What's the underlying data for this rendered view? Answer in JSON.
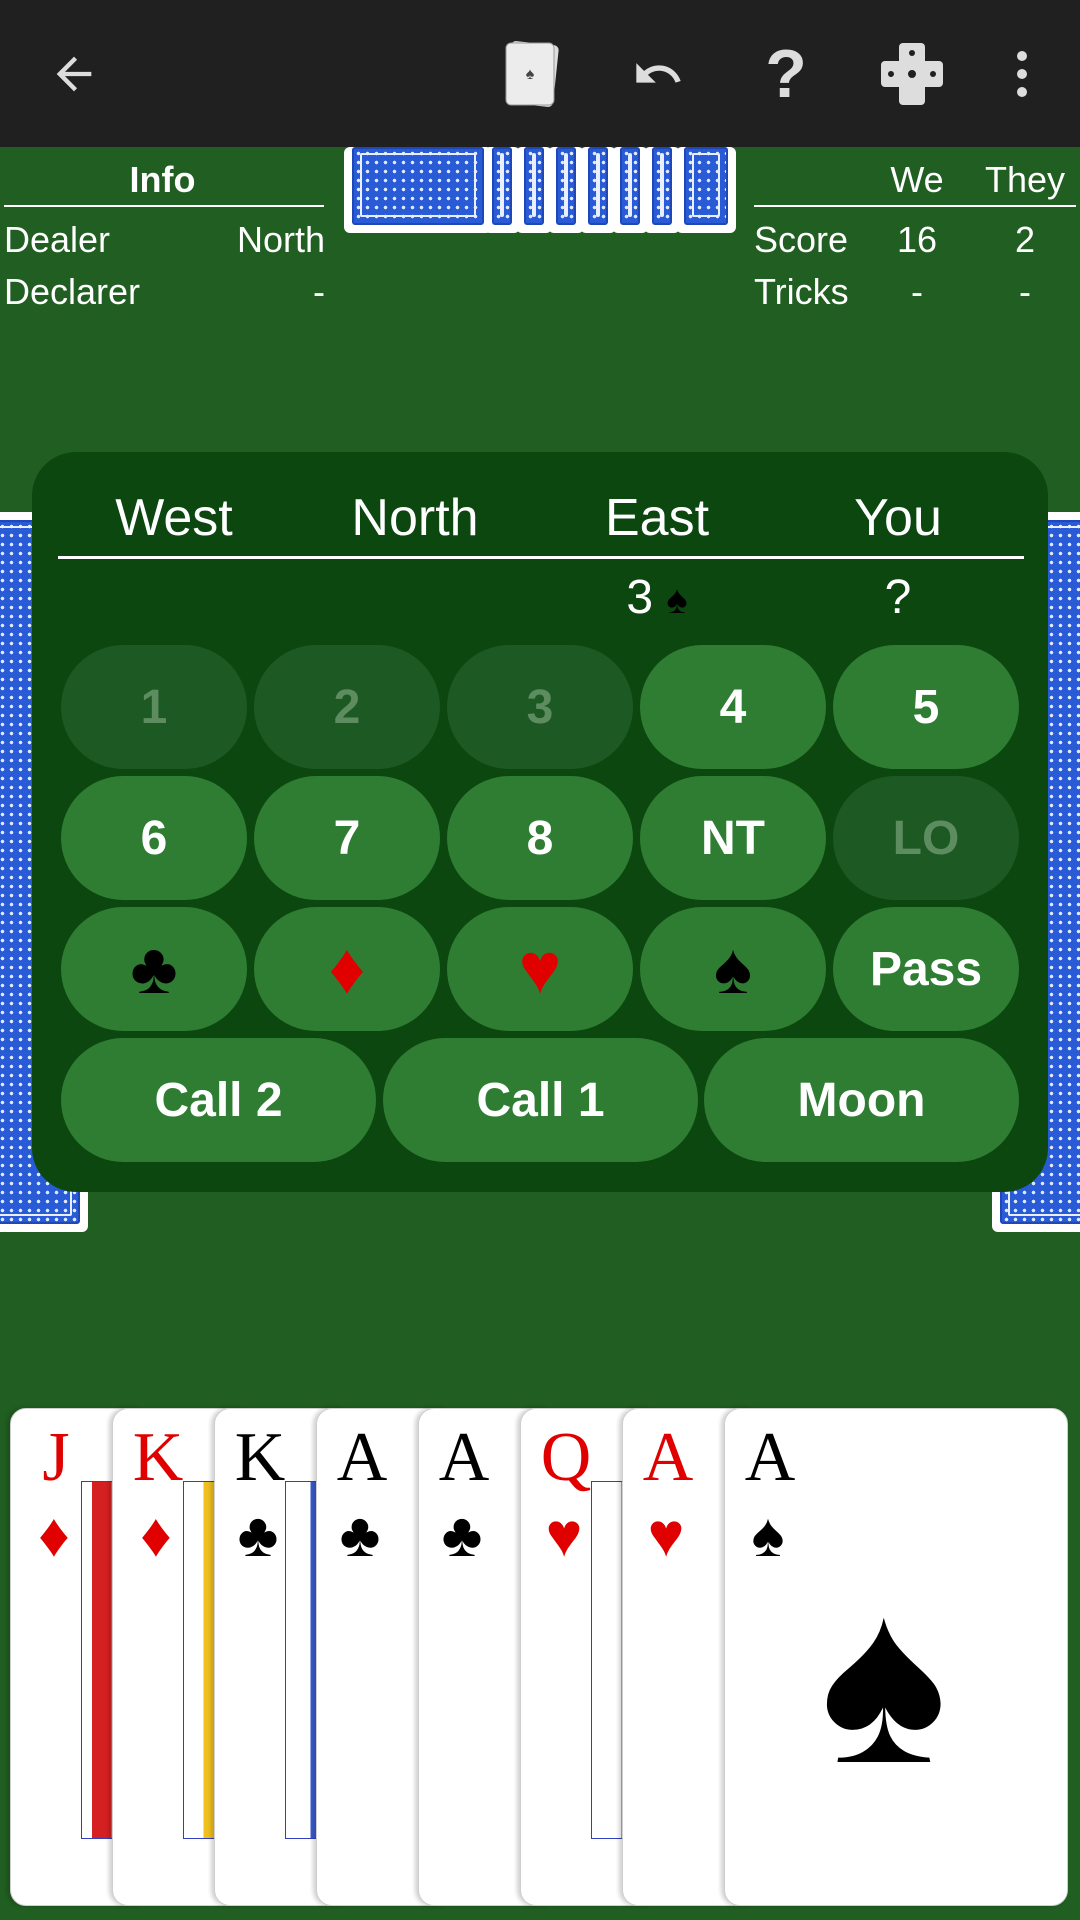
{
  "toolbar": {
    "icons": [
      "back-arrow-icon",
      "cards-icon",
      "undo-icon",
      "help-icon",
      "dice-icon",
      "more-vert-icon"
    ],
    "help_label": "?"
  },
  "info": {
    "title": "Info",
    "rows": [
      {
        "label": "Dealer",
        "value": "North"
      },
      {
        "label": "Declarer",
        "value": "-"
      }
    ]
  },
  "score": {
    "headers": [
      "We",
      "They"
    ],
    "rows": [
      {
        "label": "Score",
        "we": "16",
        "they": "2"
      },
      {
        "label": "Tricks",
        "we": "-",
        "they": "-"
      }
    ]
  },
  "bidding": {
    "seats": [
      "West",
      "North",
      "East",
      "You"
    ],
    "bids": {
      "west": "",
      "north": "",
      "east": "3",
      "east_suit": "♠",
      "you": "?"
    },
    "numbers": [
      {
        "label": "1",
        "enabled": false
      },
      {
        "label": "2",
        "enabled": false
      },
      {
        "label": "3",
        "enabled": false
      },
      {
        "label": "4",
        "enabled": true
      },
      {
        "label": "5",
        "enabled": true
      },
      {
        "label": "6",
        "enabled": true
      },
      {
        "label": "7",
        "enabled": true
      },
      {
        "label": "8",
        "enabled": true
      },
      {
        "label": "NT",
        "enabled": true
      },
      {
        "label": "LO",
        "enabled": false
      }
    ],
    "suits": [
      {
        "symbol": "♣",
        "color": "#000000",
        "name": "clubs"
      },
      {
        "symbol": "♦",
        "color": "#e00000",
        "name": "diamonds"
      },
      {
        "symbol": "♥",
        "color": "#e00000",
        "name": "hearts"
      },
      {
        "symbol": "♠",
        "color": "#000000",
        "name": "spades"
      }
    ],
    "pass_label": "Pass",
    "actions": [
      "Call 2",
      "Call 1",
      "Moon"
    ]
  },
  "hand": [
    {
      "rank": "J",
      "suit": "♦",
      "color": "red"
    },
    {
      "rank": "K",
      "suit": "♦",
      "color": "red"
    },
    {
      "rank": "K",
      "suit": "♣",
      "color": "blk"
    },
    {
      "rank": "A",
      "suit": "♣",
      "color": "blk"
    },
    {
      "rank": "A",
      "suit": "♣",
      "color": "blk"
    },
    {
      "rank": "Q",
      "suit": "♥",
      "color": "red"
    },
    {
      "rank": "A",
      "suit": "♥",
      "color": "red"
    },
    {
      "rank": "A",
      "suit": "♠",
      "color": "blk"
    }
  ],
  "colors": {
    "felt": "#215e21",
    "panel": "#0b470f",
    "button": "#2e7d32",
    "button_disabled": "#1d5a23",
    "toolbar": "#202020",
    "card_back": "#2a5bd7"
  }
}
